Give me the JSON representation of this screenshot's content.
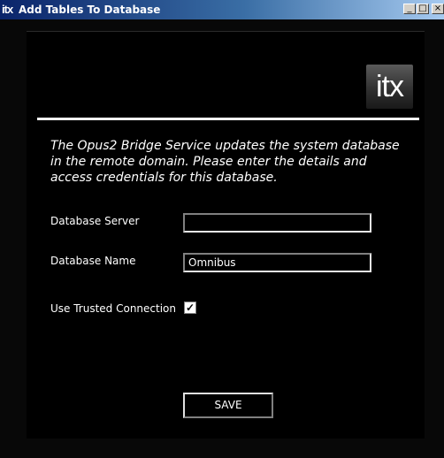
{
  "window": {
    "icon_text": "itx",
    "title": "Add Tables To Database",
    "minimize_glyph": "_",
    "maximize_glyph": "□",
    "close_glyph": "×"
  },
  "logo": {
    "text": "itx"
  },
  "intro": "The Opus2 Bridge Service updates the system database in the remote domain. Please enter the details and access credentials for this database.",
  "form": {
    "server_label": "Database Server",
    "server_value": "",
    "name_label": "Database Name",
    "name_value": "Omnibus",
    "trusted_label": "Use Trusted Connection",
    "trusted_checked": true,
    "trusted_glyph": "✓",
    "save_label": "SAVE"
  }
}
